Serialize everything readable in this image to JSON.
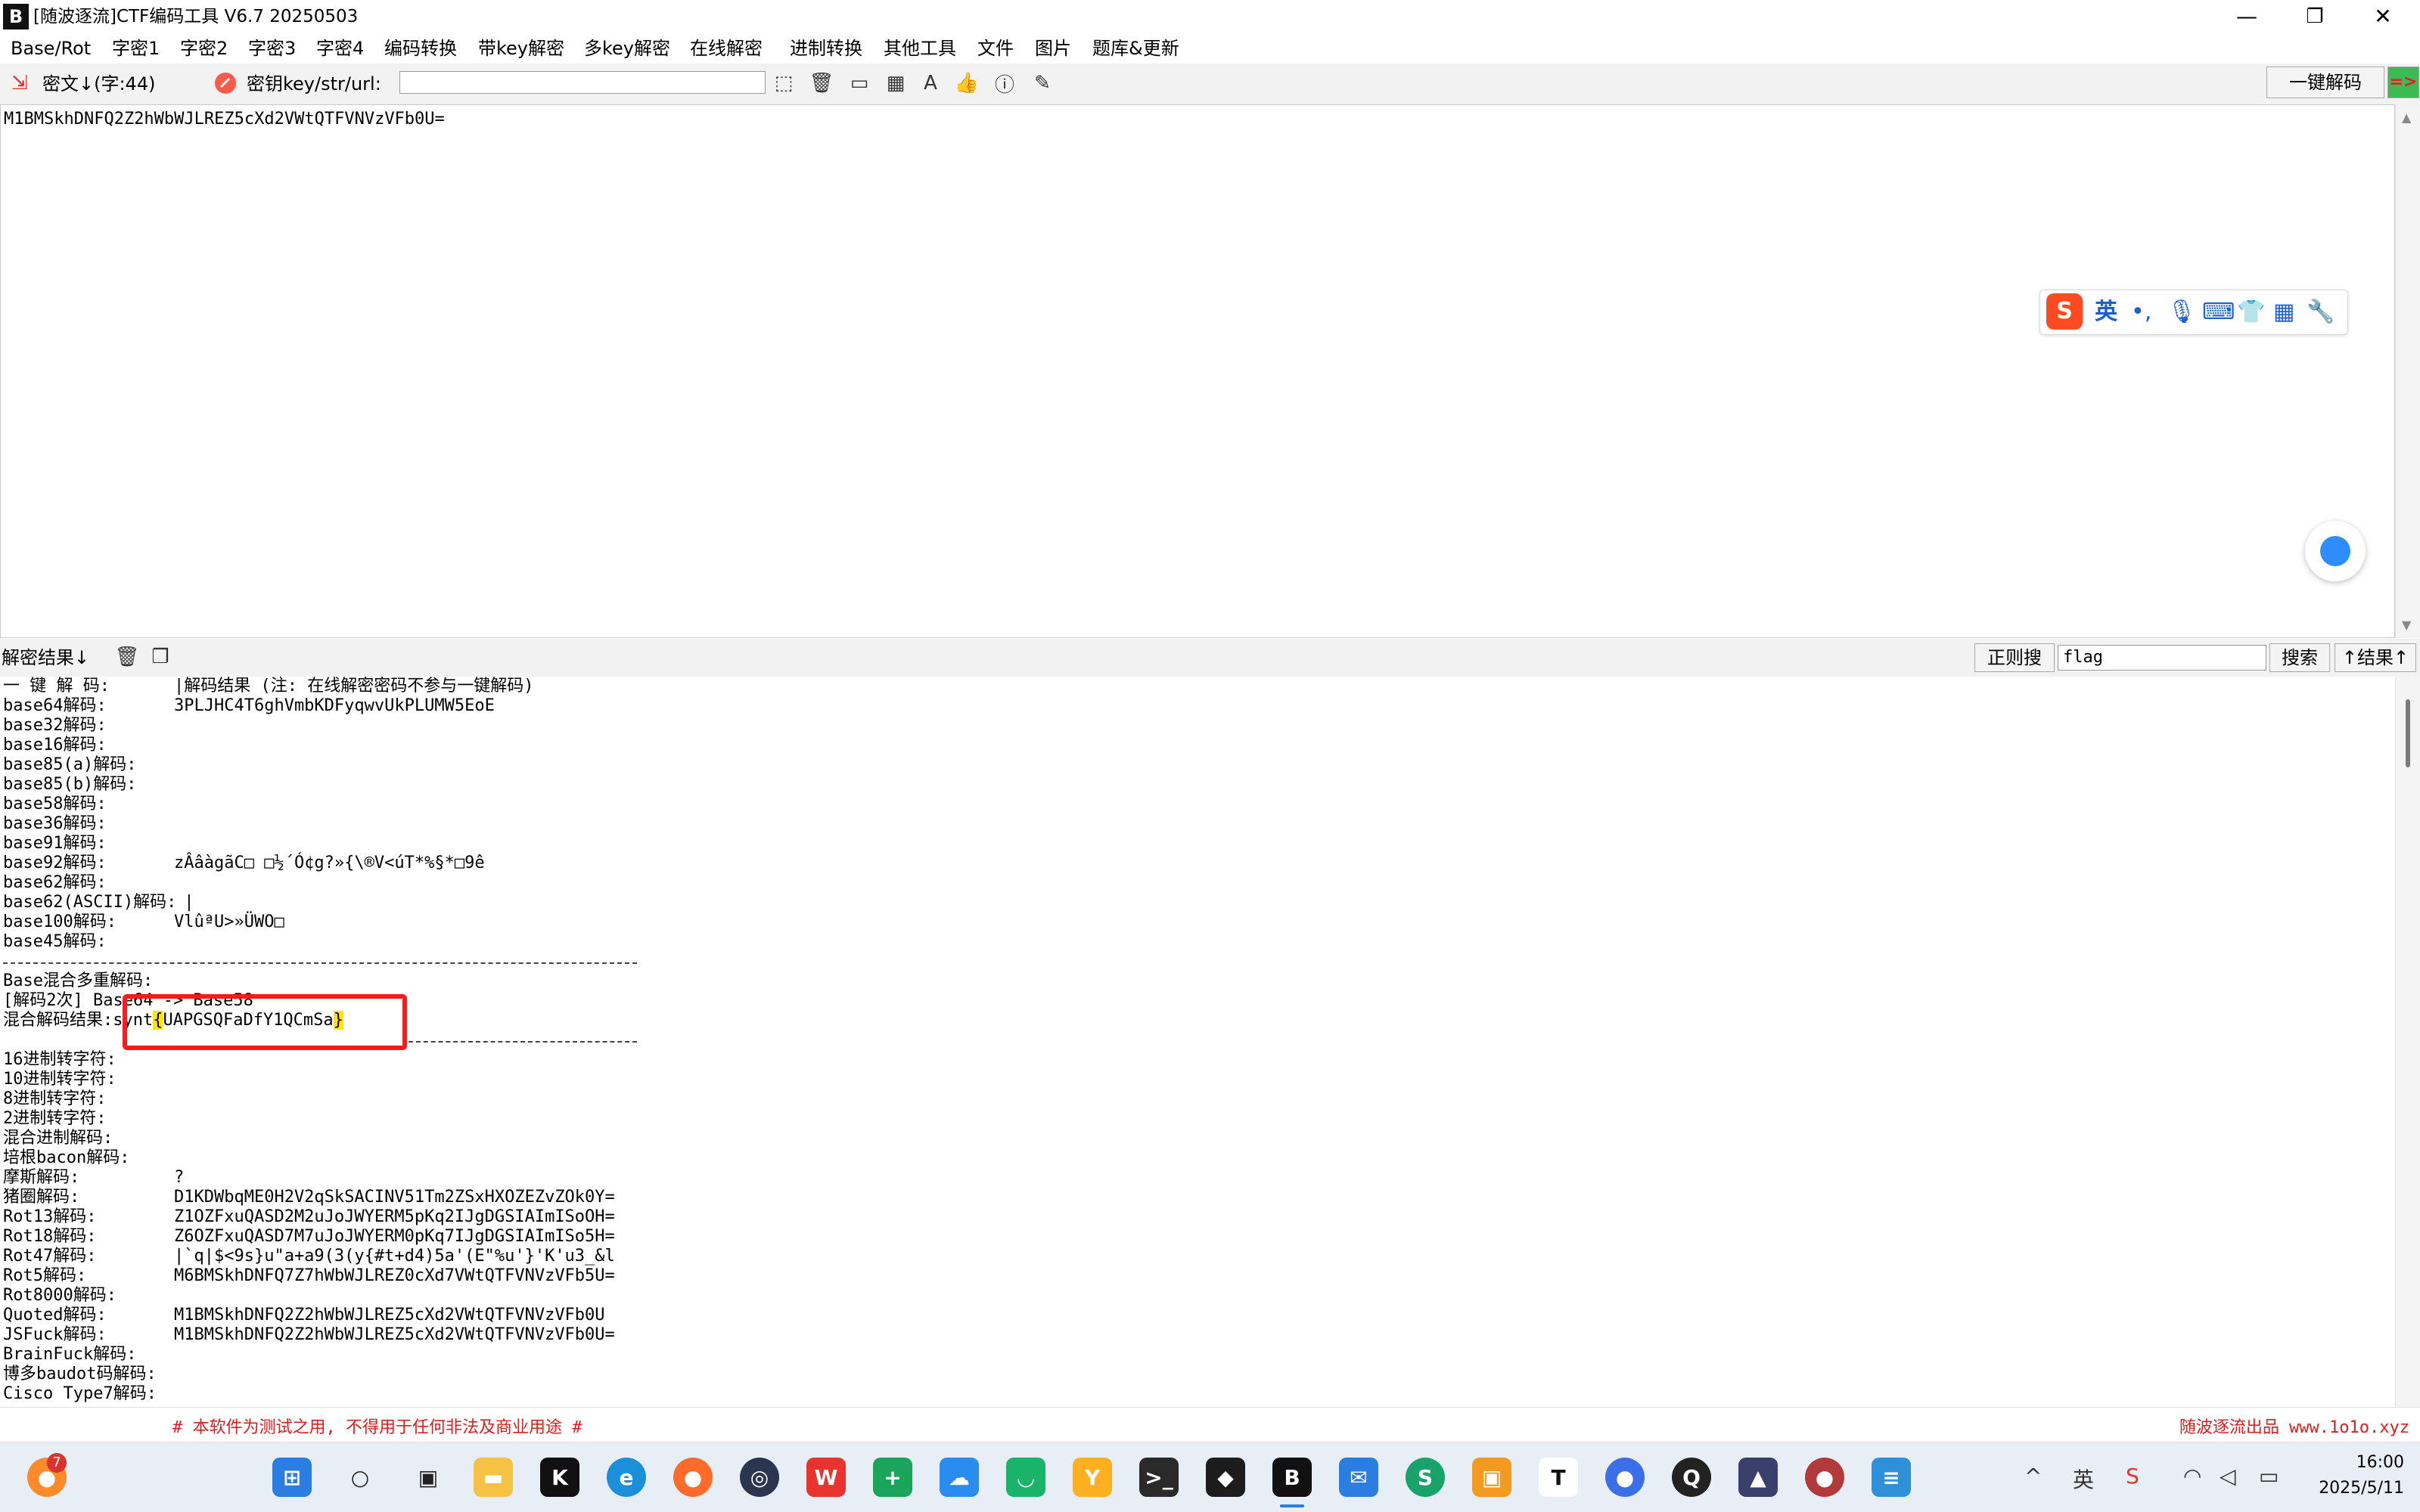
{
  "window": {
    "title": "[随波逐流]CTF编码工具 V6.7  20250503",
    "minimize": "—",
    "maximize": "❐",
    "close": "✕"
  },
  "menu": [
    "Base/Rot",
    "字密1",
    "字密2",
    "字密3",
    "字密4",
    "编码转换",
    "带key解密",
    "多key解密",
    "在线解密",
    "进制转换",
    "其他工具",
    "文件",
    "图片",
    "题库&更新"
  ],
  "toolbar": {
    "cipher_label": "密文↓(字:44)",
    "key_label": "密钥key/str/url:",
    "key_value": "",
    "one_click_label": "一键解码",
    "arrow_label": "=>"
  },
  "cipher": {
    "text": "M1BMSkhDNFQ2Z2hWbWJLREZ5cXd2VWtQTFVNVzVFb0U="
  },
  "ime": {
    "logo": "S",
    "lang": "英",
    "punct": "•,",
    "mic": "🎙",
    "keyboard": "⌨",
    "skin": "👕",
    "apps": "▦",
    "tool": "🔧"
  },
  "result_toolbar": {
    "label": "解密结果↓",
    "regex_label": "正则搜",
    "search_value": "flag",
    "search_label": "搜索",
    "result_label": "↑结果↑"
  },
  "results": {
    "header": {
      "label": "一 键 解 码:",
      "value": "|解码结果 (注: 在线解密密码不参与一键解码)"
    },
    "group1": [
      {
        "label": "base64解码:",
        "value": "3PLJHC4T6ghVmbKDFyqwvUkPLUMW5EoE"
      },
      {
        "label": "base32解码:",
        "value": ""
      },
      {
        "label": "base16解码:",
        "value": ""
      },
      {
        "label": "base85(a)解码:",
        "value": ""
      },
      {
        "label": "base85(b)解码:",
        "value": ""
      },
      {
        "label": "base58解码:",
        "value": ""
      },
      {
        "label": "base36解码:",
        "value": ""
      },
      {
        "label": "base91解码:",
        "value": ""
      },
      {
        "label": "base92解码:",
        "value": "zÂâàgãC□ □½´Ó¢g?»{\\®V<úT*%§*□9ê"
      },
      {
        "label": "base62解码:",
        "value": ""
      },
      {
        "label": "base62(ASCII)解码:",
        "value": " |"
      },
      {
        "label": "base100解码:",
        "value": "VlûªU>»ÜWO□"
      },
      {
        "label": "base45解码:",
        "value": ""
      }
    ],
    "separator": "----------------------------------------------------------------",
    "mixed": {
      "title": "Base混合多重解码:",
      "step": "[解码2次] Base64 -> Base58",
      "result_label": "混合解码结果:",
      "result_prefix": "synt",
      "result_open": "{",
      "result_body": "UAPGSQFaDfY1QCmSa",
      "result_close": "}"
    },
    "group2": [
      {
        "label": "16进制转字符:",
        "value": ""
      },
      {
        "label": "10进制转字符:",
        "value": ""
      },
      {
        "label": "8进制转字符:",
        "value": ""
      },
      {
        "label": "2进制转字符:",
        "value": ""
      },
      {
        "label": "混合进制解码:",
        "value": ""
      },
      {
        "label": "培根bacon解码:",
        "value": ""
      },
      {
        "label": "摩斯解码:",
        "value": "?"
      },
      {
        "label": "猪圈解码:",
        "value": "D1KDWbqME0H2V2qSkSACINV51Tm2ZSxHXOZEZvZOk0Y="
      },
      {
        "label": "Rot13解码:",
        "value": "Z1OZFxuQASD2M2uJoJWYERM5pKq2IJgDGSIAImISoOH="
      },
      {
        "label": "Rot18解码:",
        "value": "Z6OZFxuQASD7M7uJoJWYERM0pKq7IJgDGSIAImISo5H="
      },
      {
        "label": "Rot47解码:",
        "value": "|`q|$<9s}u\"a+a9(3(y{#t+d4)5a'(E\"%u'}'K'u3_&l"
      },
      {
        "label": "Rot5解码:",
        "value": "M6BMSkhDNFQ7Z7hWbWJLREZ0cXd7VWtQTFVNVzVFb5U="
      },
      {
        "label": "Rot8000解码:",
        "value": ""
      },
      {
        "label": "Quoted解码:",
        "value": "M1BMSkhDNFQ2Z2hWbWJLREZ5cXd2VWtQTFVNVzVFb0U"
      },
      {
        "label": "JSFuck解码:",
        "value": "M1BMSkhDNFQ2Z2hWbWJLREZ5cXd2VWtQTFVNVzVFb0U="
      },
      {
        "label": "BrainFuck解码:",
        "value": ""
      },
      {
        "label": "博多baudot码解码:",
        "value": ""
      },
      {
        "label": "Cisco Type7解码:",
        "value": ""
      }
    ]
  },
  "footer": {
    "left": "# 本软件为测试之用, 不得用于任何非法及商业用途 #",
    "right": "随波逐流出品 www.1o1o.xyz"
  },
  "taskbar": {
    "badge": "7",
    "time": "16:00",
    "date": "2025/5/11",
    "tray_lang": "英",
    "tray_up": "^"
  },
  "colors": {
    "accent_red": "#ff1a1a",
    "highlight_yellow": "#ffe400",
    "footer_red": "#d92020",
    "taskbar_bg": "#e8eef6"
  }
}
